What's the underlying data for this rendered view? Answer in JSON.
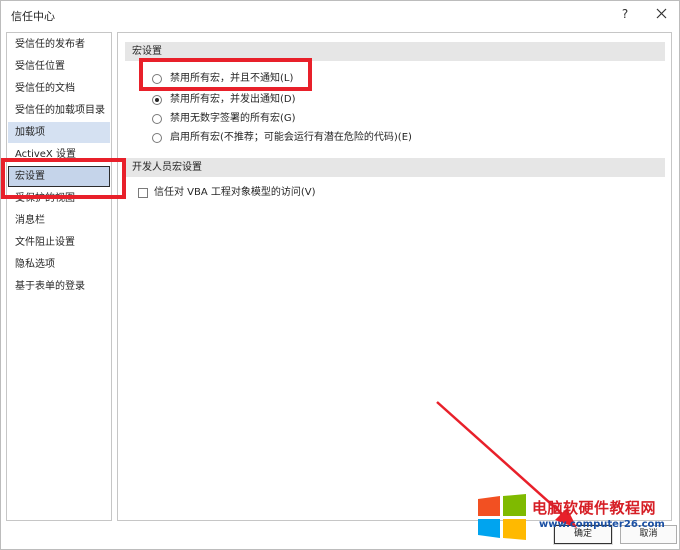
{
  "window": {
    "title": "信任中心",
    "help_label": "?"
  },
  "sidebar": {
    "items": [
      {
        "label": "受信任的发布者"
      },
      {
        "label": "受信任位置"
      },
      {
        "label": "受信任的文档"
      },
      {
        "label": "受信任的加载项目录"
      },
      {
        "label": "加载项"
      },
      {
        "label": "ActiveX 设置"
      },
      {
        "label": "宏设置"
      },
      {
        "label": "受保护的视图"
      },
      {
        "label": "消息栏"
      },
      {
        "label": "文件阻止设置"
      },
      {
        "label": "隐私选项"
      },
      {
        "label": "基于表单的登录"
      }
    ],
    "selected_index": 6
  },
  "macro_settings": {
    "header": "宏设置",
    "options": [
      {
        "label": "禁用所有宏，并且不通知(L)",
        "checked": false
      },
      {
        "label": "禁用所有宏，并发出通知(D)",
        "checked": true
      },
      {
        "label": "禁用无数字签署的所有宏(G)",
        "checked": false
      },
      {
        "label": "启用所有宏(不推荐；可能会运行有潜在危险的代码)(E)",
        "checked": false
      }
    ]
  },
  "developer_settings": {
    "header": "开发人员宏设置",
    "trust_vba_label": "信任对 VBA 工程对象模型的访问(V)",
    "trust_vba_checked": false
  },
  "buttons": {
    "ok_label": "确定",
    "cancel_label": "取消"
  },
  "watermark": {
    "title": "电脑软硬件教程网",
    "url": "www.computer26.com"
  },
  "colors": {
    "annotation_red": "#e8202a",
    "selected_bg": "#d5e1f2",
    "section_header_bg": "#e6e6e6"
  }
}
